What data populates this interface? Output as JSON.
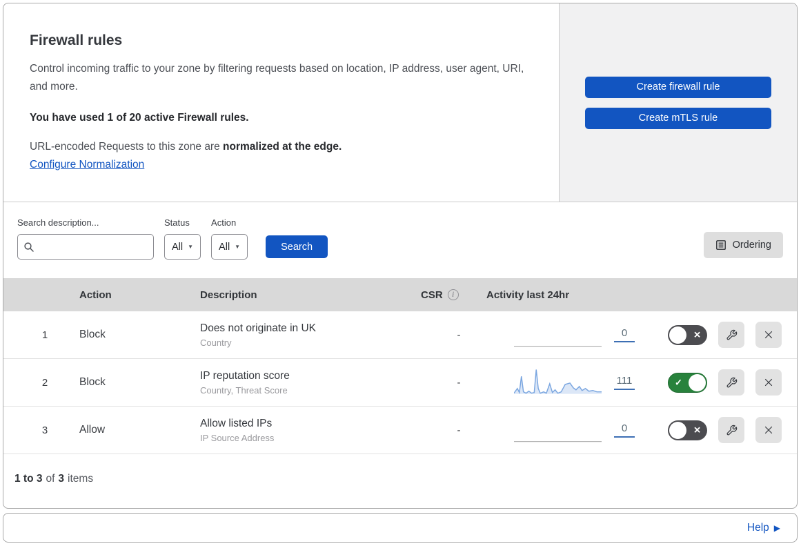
{
  "hero": {
    "title": "Firewall rules",
    "description": "Control incoming traffic to your zone by filtering requests based on location, IP address, user agent, URI, and more.",
    "usage": "You have used 1 of 20 active Firewall rules.",
    "norm_prefix": "URL-encoded Requests to this zone are ",
    "norm_bold": "normalized at the edge.",
    "norm_link": "Configure Normalization",
    "create_firewall_button": "Create firewall rule",
    "create_mtls_button": "Create mTLS rule"
  },
  "filters": {
    "search_label": "Search description...",
    "status_label": "Status",
    "status_value": "All",
    "action_label": "Action",
    "action_value": "All",
    "search_button": "Search",
    "ordering_button": "Ordering"
  },
  "table": {
    "columns": {
      "action": "Action",
      "description": "Description",
      "csr": "CSR",
      "activity": "Activity last 24hr"
    },
    "rows": [
      {
        "index": "1",
        "action": "Block",
        "description": "Does not originate in UK",
        "fields": "Country",
        "csr": "-",
        "activity_count": "0",
        "enabled": false,
        "sparkline": []
      },
      {
        "index": "2",
        "action": "Block",
        "description": "IP reputation score",
        "fields": "Country, Threat Score",
        "csr": "-",
        "activity_count": "111",
        "enabled": true,
        "sparkline": [
          [
            0,
            37
          ],
          [
            5,
            30
          ],
          [
            8,
            36
          ],
          [
            11,
            12
          ],
          [
            14,
            35
          ],
          [
            18,
            37
          ],
          [
            22,
            34
          ],
          [
            26,
            37
          ],
          [
            30,
            36
          ],
          [
            33,
            2
          ],
          [
            36,
            30
          ],
          [
            39,
            37
          ],
          [
            44,
            35
          ],
          [
            48,
            37
          ],
          [
            53,
            23
          ],
          [
            57,
            36
          ],
          [
            61,
            32
          ],
          [
            65,
            37
          ],
          [
            70,
            35
          ],
          [
            76,
            24
          ],
          [
            83,
            22
          ],
          [
            88,
            29
          ],
          [
            92,
            32
          ],
          [
            97,
            27
          ],
          [
            101,
            33
          ],
          [
            106,
            30
          ],
          [
            111,
            34
          ],
          [
            117,
            33
          ],
          [
            123,
            35
          ],
          [
            130,
            35
          ]
        ]
      },
      {
        "index": "3",
        "action": "Allow",
        "description": "Allow listed IPs",
        "fields": "IP Source Address",
        "csr": "-",
        "activity_count": "0",
        "enabled": false,
        "sparkline": []
      }
    ],
    "pagination": {
      "range": "1 to 3",
      "of_label": "of",
      "total": "3",
      "items_label": "items"
    }
  },
  "footer": {
    "help": "Help"
  },
  "icons": {
    "info_glyph": "i",
    "dropdown_arrow": "▼",
    "help_arrow": "▶",
    "toggle_on_glyph": "✓",
    "toggle_off_glyph": "✕"
  },
  "colors": {
    "accent_blue": "#1255c1",
    "toggle_green": "#28823c",
    "toggle_off_gray": "#4c4c50",
    "table_header_bg": "#d9d9d9",
    "panel_gray": "#f1f1f2",
    "sparkline_line": "#7aa6e0",
    "sparkline_fill": "#dce7f7",
    "flat_line": "#b3b3b3",
    "count_underline": "#3d6fb4"
  }
}
